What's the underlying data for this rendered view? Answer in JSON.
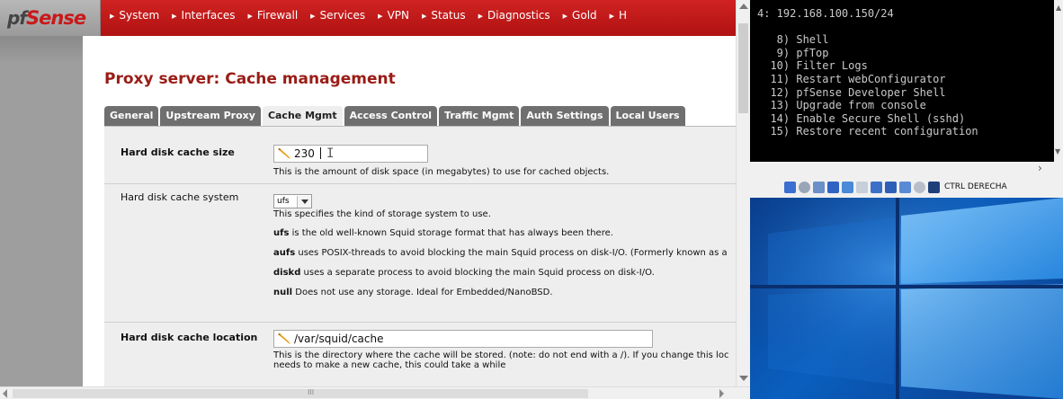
{
  "logo": {
    "prefix": "pf",
    "text": "Sense"
  },
  "menu": [
    {
      "label": "System"
    },
    {
      "label": "Interfaces"
    },
    {
      "label": "Firewall"
    },
    {
      "label": "Services"
    },
    {
      "label": "VPN"
    },
    {
      "label": "Status"
    },
    {
      "label": "Diagnostics"
    },
    {
      "label": "Gold"
    },
    {
      "label": "H"
    }
  ],
  "page": {
    "title": "Proxy server: Cache management"
  },
  "tabs": [
    {
      "label": "General"
    },
    {
      "label": "Upstream Proxy"
    },
    {
      "label": "Cache Mgmt",
      "active": true
    },
    {
      "label": "Access Control"
    },
    {
      "label": "Traffic Mgmt"
    },
    {
      "label": "Auth Settings"
    },
    {
      "label": "Local Users"
    }
  ],
  "form": {
    "cache_size": {
      "label": "Hard disk cache size",
      "value": "230",
      "desc": "This is the amount of disk space (in megabytes) to use for cached objects."
    },
    "cache_system": {
      "label": "Hard disk cache system",
      "value": "ufs",
      "desc": "This specifies the kind of storage system to use.",
      "options": [
        {
          "name": "ufs",
          "text": " is the old well-known Squid storage format that has always been there."
        },
        {
          "name": "aufs",
          "text": " uses POSIX-threads to avoid blocking the main Squid process on disk-I/O. (Formerly known as a"
        },
        {
          "name": "diskd",
          "text": " uses a separate process to avoid blocking the main Squid process on disk-I/O."
        },
        {
          "name": "null",
          "text": " Does not use any storage. Ideal for Embedded/NanoBSD."
        }
      ]
    },
    "cache_location": {
      "label": "Hard disk cache location",
      "value": "/var/squid/cache",
      "desc1": "This is the directory where the cache will be stored. (note: do not end with a /). If you change this loc",
      "desc2": "needs to make a new cache, this could take a while"
    }
  },
  "console": {
    "text": "4: 192.168.100.150/24\n\n   8) Shell\n   9) pfTop\n  10) Filter Logs\n  11) Restart webConfigurator\n  12) pfSense Developer Shell\n  13) Upgrade from console\n  14) Enable Secure Shell (sshd)\n  15) Restore recent configuration"
  },
  "vm_status": {
    "host_key": "CTRL DERECHA"
  },
  "colors": {
    "menu_red": "#c41a1a",
    "title_red": "#9a1c16",
    "tab_gray": "#6f6f6f"
  }
}
